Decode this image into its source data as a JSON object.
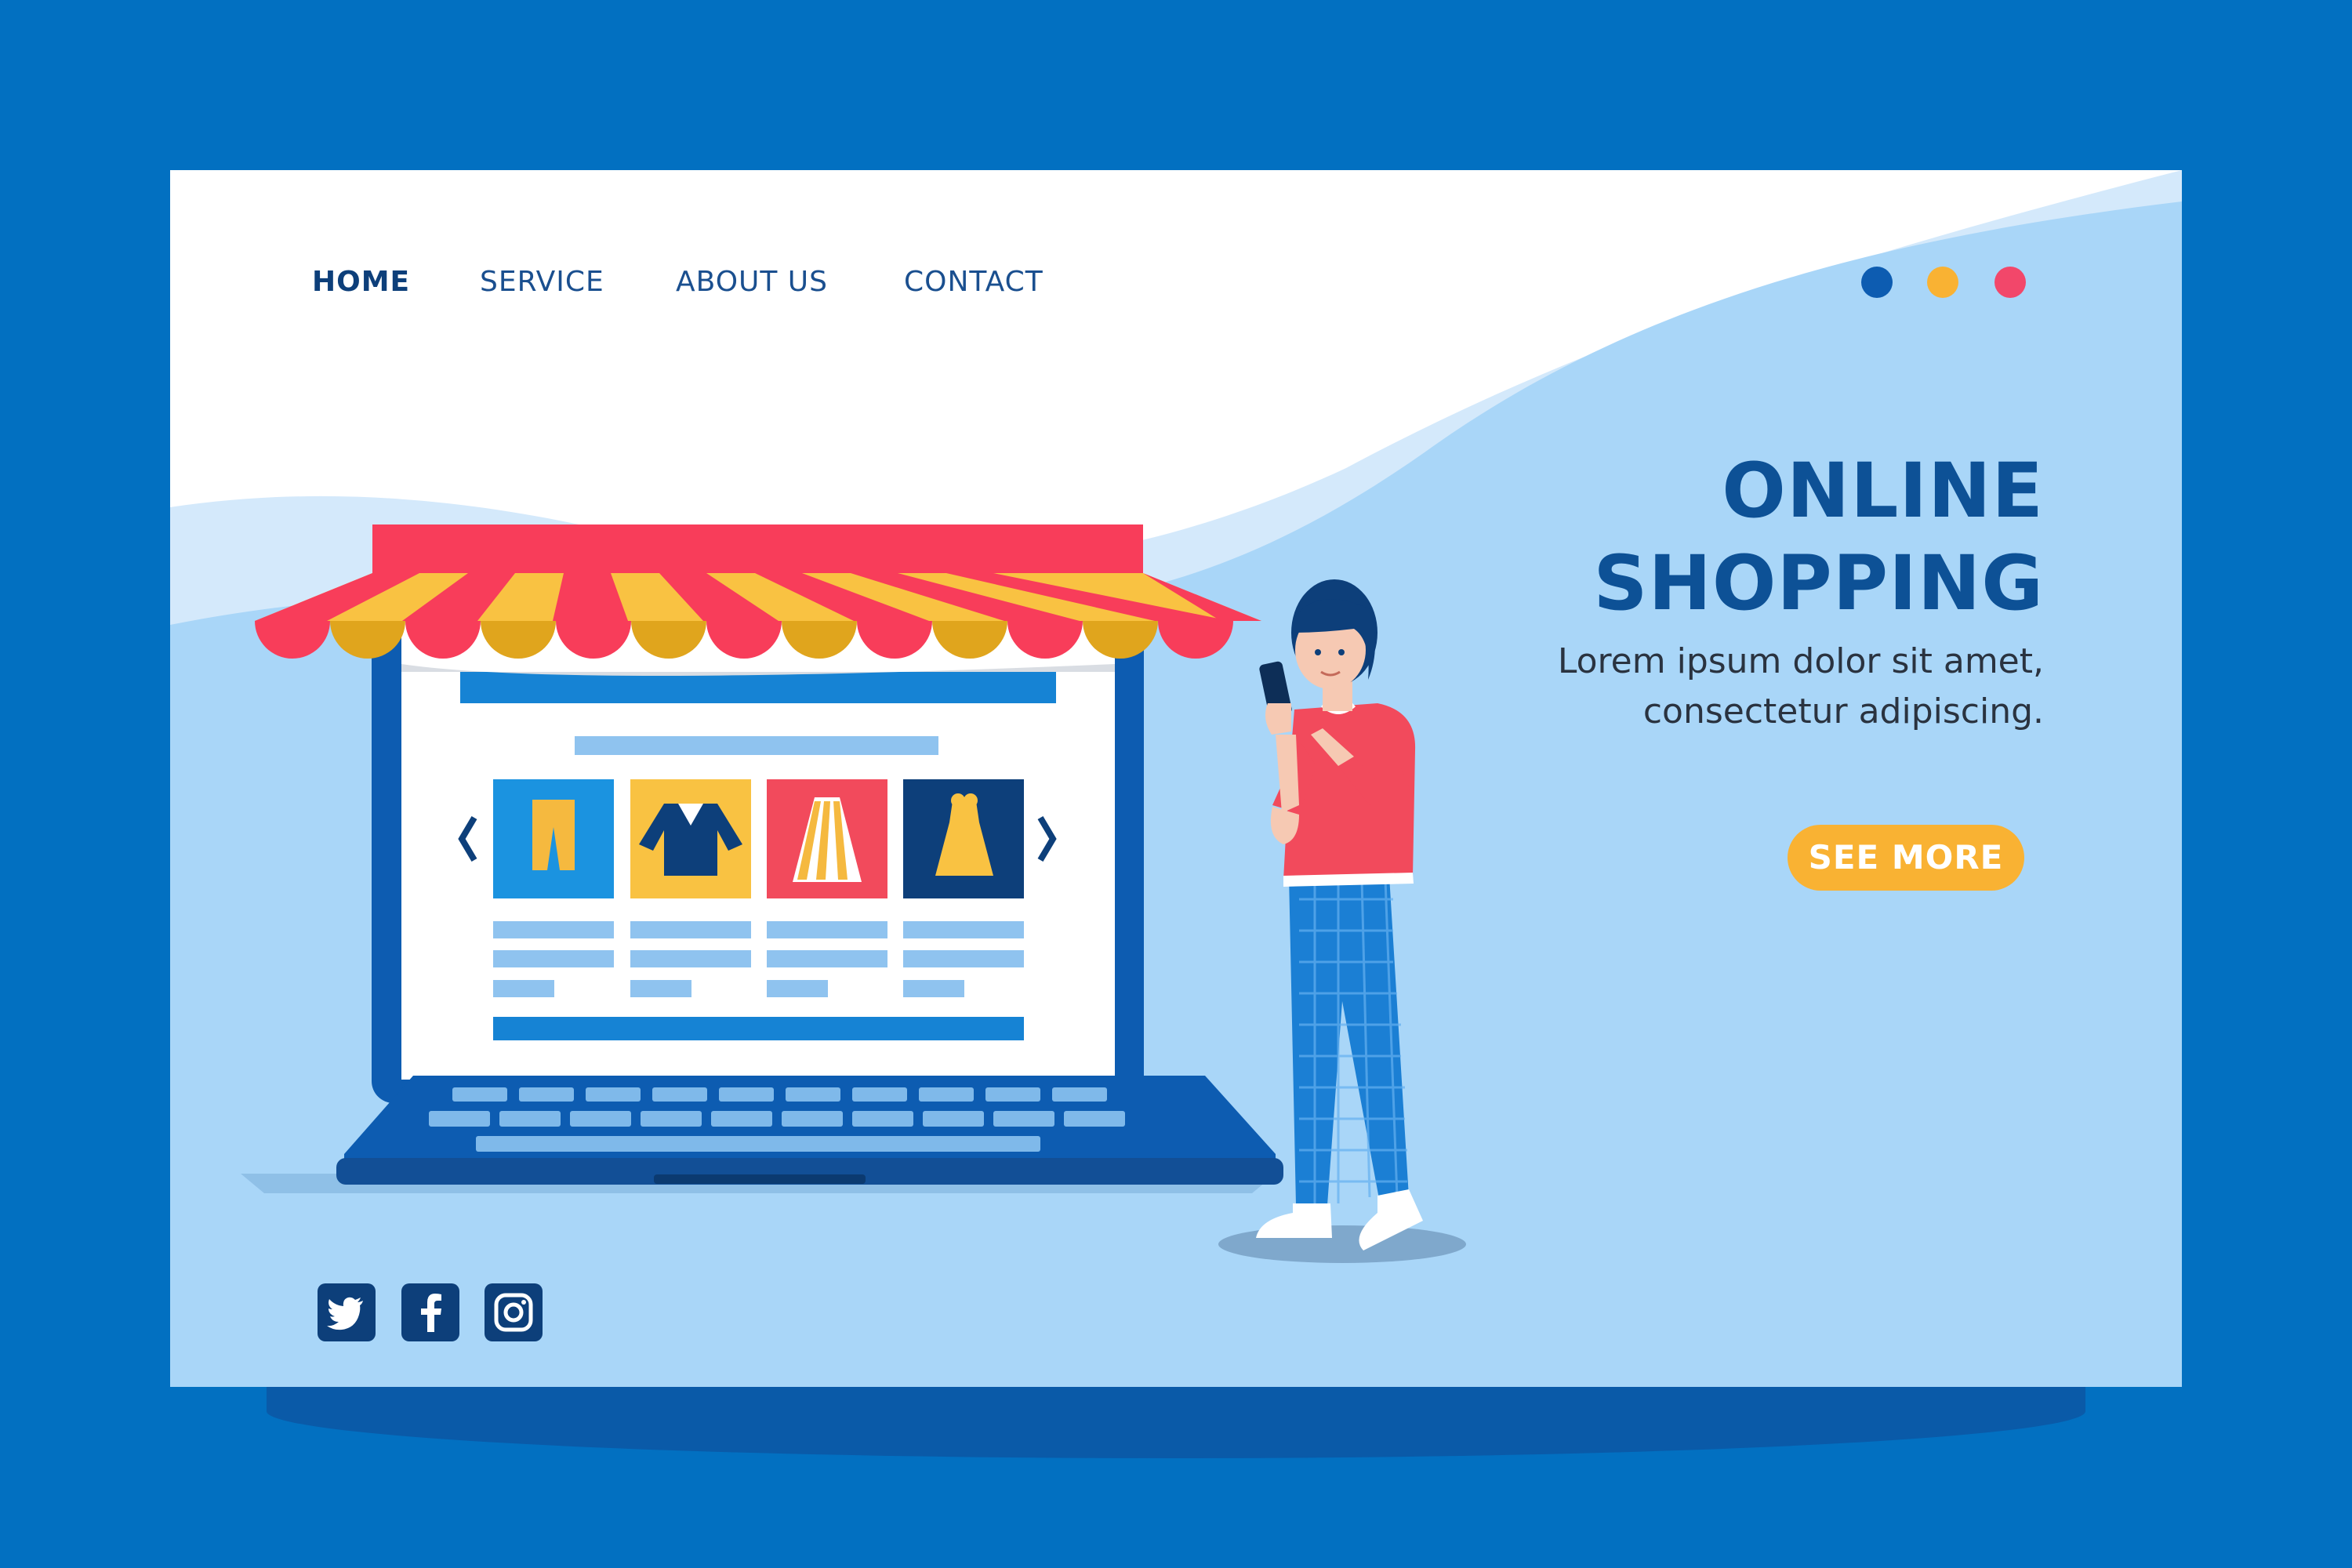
{
  "nav": {
    "items": [
      {
        "label": "HOME",
        "active": true
      },
      {
        "label": "SERVICE",
        "active": false
      },
      {
        "label": "ABOUT US",
        "active": false
      },
      {
        "label": "CONTACT",
        "active": false
      }
    ]
  },
  "window_dots": {
    "colors": [
      "#0d5cb1",
      "#f9b233",
      "#f2476a"
    ]
  },
  "hero": {
    "title_line1": "ONLINE",
    "title_line2": "SHOPPING",
    "subtitle_line1": "Lorem ipsum dolor sit amet,",
    "subtitle_line2": "consectetur adipiscing.",
    "cta_label": "SEE MORE"
  },
  "illustration": {
    "products": [
      "pants",
      "sweater",
      "skirt",
      "dress"
    ],
    "arrows": [
      "chevron-left-icon",
      "chevron-right-icon"
    ]
  },
  "social": {
    "icons": [
      "twitter-icon",
      "facebook-icon",
      "instagram-icon"
    ]
  },
  "colors": {
    "brand_blue": "#0270c1",
    "navy": "#0d3f7a",
    "accent_yellow": "#f9b233",
    "accent_red": "#f83d5a",
    "light_blue": "#a9d6f8"
  }
}
